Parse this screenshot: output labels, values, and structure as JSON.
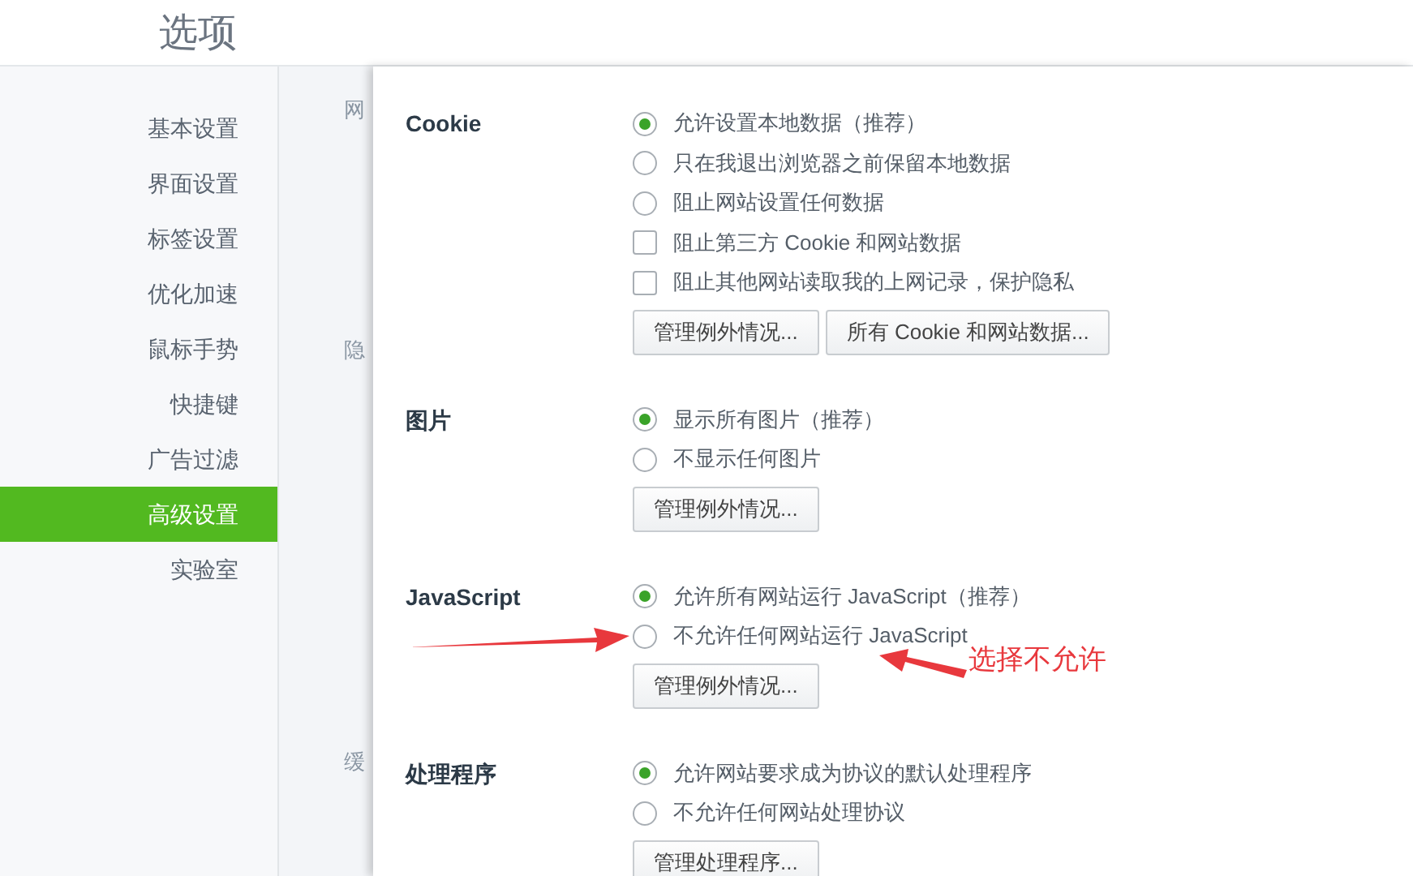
{
  "window": {
    "title": "选项"
  },
  "sidebar": {
    "items": [
      {
        "label": "基本设置",
        "selected": false
      },
      {
        "label": "界面设置",
        "selected": false
      },
      {
        "label": "标签设置",
        "selected": false
      },
      {
        "label": "优化加速",
        "selected": false
      },
      {
        "label": "鼠标手势",
        "selected": false
      },
      {
        "label": "快捷键",
        "selected": false
      },
      {
        "label": "广告过滤",
        "selected": false
      },
      {
        "label": "高级设置",
        "selected": true
      },
      {
        "label": "实验室",
        "selected": false
      }
    ]
  },
  "background_labels": [
    "网",
    "隐",
    "缓"
  ],
  "sections": [
    {
      "title": "Cookie",
      "options": [
        {
          "kind": "radio",
          "label": "允许设置本地数据（推荐）",
          "checked": true
        },
        {
          "kind": "radio",
          "label": "只在我退出浏览器之前保留本地数据",
          "checked": false
        },
        {
          "kind": "radio",
          "label": "阻止网站设置任何数据",
          "checked": false
        },
        {
          "kind": "checkbox",
          "label": "阻止第三方 Cookie 和网站数据",
          "checked": false
        },
        {
          "kind": "checkbox",
          "label": "阻止其他网站读取我的上网记录，保护隐私",
          "checked": false
        }
      ],
      "buttons": [
        "管理例外情况...",
        "所有 Cookie 和网站数据..."
      ]
    },
    {
      "title": "图片",
      "options": [
        {
          "kind": "radio",
          "label": "显示所有图片（推荐）",
          "checked": true
        },
        {
          "kind": "radio",
          "label": "不显示任何图片",
          "checked": false
        }
      ],
      "buttons": [
        "管理例外情况..."
      ]
    },
    {
      "title": "JavaScript",
      "options": [
        {
          "kind": "radio",
          "label": "允许所有网站运行 JavaScript（推荐）",
          "checked": true
        },
        {
          "kind": "radio",
          "label": "不允许任何网站运行 JavaScript",
          "checked": false
        }
      ],
      "buttons": [
        "管理例外情况..."
      ]
    },
    {
      "title": "处理程序",
      "options": [
        {
          "kind": "radio",
          "label": "允许网站要求成为协议的默认处理程序",
          "checked": true
        },
        {
          "kind": "radio",
          "label": "不允许任何网站处理协议",
          "checked": false
        }
      ],
      "buttons": [
        "管理处理程序..."
      ]
    }
  ],
  "annotation": {
    "text": "选择不允许"
  }
}
